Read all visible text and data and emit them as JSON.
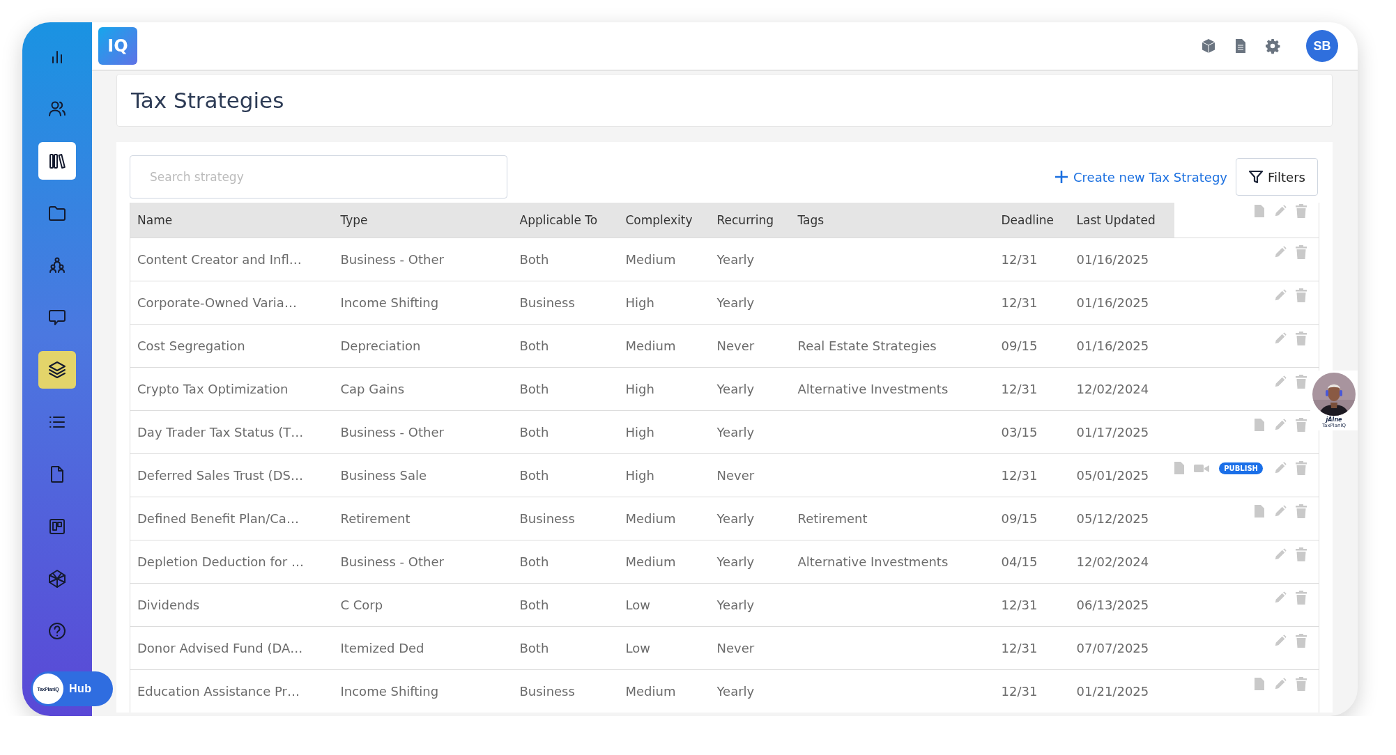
{
  "app": {
    "logo": "IQ"
  },
  "sidebar": {
    "items": [
      {
        "kind": "chart",
        "selected": false,
        "pinned": false
      },
      {
        "kind": "users",
        "selected": false,
        "pinned": false
      },
      {
        "kind": "library",
        "selected": false,
        "pinned": true
      },
      {
        "kind": "folder",
        "selected": false,
        "pinned": false
      },
      {
        "kind": "team",
        "selected": false,
        "pinned": false
      },
      {
        "kind": "chat",
        "selected": false,
        "pinned": false
      },
      {
        "kind": "layers",
        "selected": true,
        "pinned": false
      },
      {
        "kind": "list",
        "selected": false,
        "pinned": false
      },
      {
        "kind": "file",
        "selected": false,
        "pinned": false
      },
      {
        "kind": "board",
        "selected": false,
        "pinned": false
      },
      {
        "kind": "polyhedron",
        "selected": false,
        "pinned": false
      },
      {
        "kind": "help",
        "selected": false,
        "pinned": false
      }
    ],
    "hub": {
      "logo": "TaxPlanIQ",
      "label": "Hub"
    }
  },
  "topbar": {
    "icons": [
      {
        "kind": "cube"
      },
      {
        "kind": "document"
      },
      {
        "kind": "settings"
      }
    ],
    "avatar": "SB"
  },
  "page": {
    "title": "Tax Strategies"
  },
  "toolbar": {
    "search": {
      "placeholder": "Search strategy"
    },
    "create_link": "Create new Tax Strategy",
    "filters_button": "Filters"
  },
  "table": {
    "columns": [
      "Name",
      "Type",
      "Applicable To",
      "Complexity",
      "Recurring",
      "Tags",
      "Deadline",
      "Last Updated"
    ],
    "header_actions": [
      {
        "kind": "document"
      },
      {
        "kind": "edit"
      },
      {
        "kind": "delete"
      }
    ],
    "rows": [
      {
        "cells": [
          "Content Creator and Infl…",
          "Business - Other",
          "Both",
          "Medium",
          "Yearly",
          "",
          "12/31",
          "01/16/2025"
        ],
        "actions": [
          {
            "kind": "edit"
          },
          {
            "kind": "delete"
          }
        ]
      },
      {
        "cells": [
          "Corporate-Owned Varia…",
          "Income Shifting",
          "Business",
          "High",
          "Yearly",
          "",
          "12/31",
          "01/16/2025"
        ],
        "actions": [
          {
            "kind": "edit"
          },
          {
            "kind": "delete"
          }
        ]
      },
      {
        "cells": [
          "Cost Segregation",
          "Depreciation",
          "Both",
          "Medium",
          "Never",
          "Real Estate Strategies",
          "09/15",
          "01/16/2025"
        ],
        "actions": [
          {
            "kind": "edit"
          },
          {
            "kind": "delete"
          }
        ]
      },
      {
        "cells": [
          "Crypto Tax Optimization",
          "Cap Gains",
          "Both",
          "High",
          "Yearly",
          "Alternative Investments",
          "12/31",
          "12/02/2024"
        ],
        "actions": [
          {
            "kind": "edit"
          },
          {
            "kind": "delete"
          }
        ]
      },
      {
        "cells": [
          "Day Trader Tax Status (T…",
          "Business - Other",
          "Both",
          "High",
          "Yearly",
          "",
          "03/15",
          "01/17/2025"
        ],
        "actions": [
          {
            "kind": "document"
          },
          {
            "kind": "edit"
          },
          {
            "kind": "delete"
          }
        ]
      },
      {
        "cells": [
          "Deferred Sales Trust (DS…",
          "Business Sale",
          "Both",
          "High",
          "Never",
          "",
          "12/31",
          "05/01/2025"
        ],
        "actions": [
          {
            "kind": "document"
          },
          {
            "kind": "video"
          },
          {
            "kind": "badge",
            "label": "PUBLISH"
          },
          {
            "kind": "edit"
          },
          {
            "kind": "delete"
          }
        ]
      },
      {
        "cells": [
          "Defined Benefit Plan/Ca…",
          "Retirement",
          "Business",
          "Medium",
          "Yearly",
          "Retirement",
          "09/15",
          "05/12/2025"
        ],
        "actions": [
          {
            "kind": "document"
          },
          {
            "kind": "edit"
          },
          {
            "kind": "delete"
          }
        ]
      },
      {
        "cells": [
          "Depletion Deduction for …",
          "Business - Other",
          "Both",
          "Medium",
          "Yearly",
          "Alternative Investments",
          "04/15",
          "12/02/2024"
        ],
        "actions": [
          {
            "kind": "edit"
          },
          {
            "kind": "delete"
          }
        ]
      },
      {
        "cells": [
          "Dividends",
          "C Corp",
          "Both",
          "Low",
          "Yearly",
          "",
          "12/31",
          "06/13/2025"
        ],
        "actions": [
          {
            "kind": "edit"
          },
          {
            "kind": "delete"
          }
        ]
      },
      {
        "cells": [
          "Donor Advised Fund (DA…",
          "Itemized Ded",
          "Both",
          "Low",
          "Never",
          "",
          "12/31",
          "07/07/2025"
        ],
        "actions": [
          {
            "kind": "edit"
          },
          {
            "kind": "delete"
          }
        ]
      },
      {
        "cells": [
          "Education Assistance Pr…",
          "Income Shifting",
          "Business",
          "Medium",
          "Yearly",
          "",
          "12/31",
          "01/21/2025"
        ],
        "actions": [
          {
            "kind": "document"
          },
          {
            "kind": "edit"
          },
          {
            "kind": "delete"
          }
        ]
      }
    ]
  },
  "assistant": {
    "name": "jAIne",
    "brand": "TaxPlanIQ"
  }
}
